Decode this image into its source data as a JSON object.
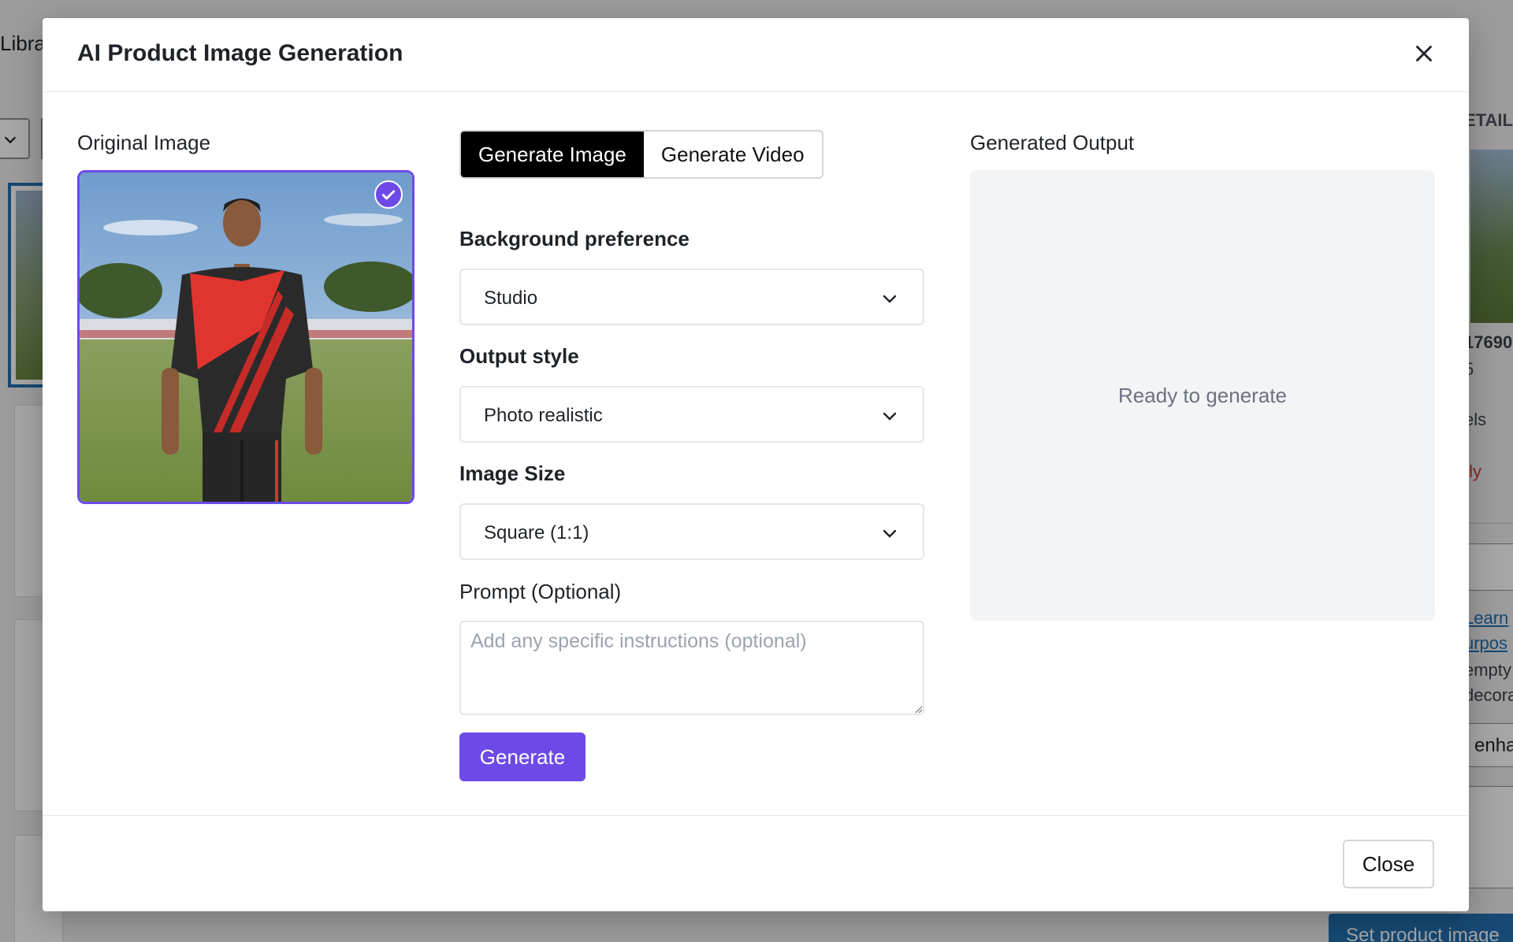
{
  "background": {
    "tab_label": "Libra",
    "right_panel": {
      "header": "ETAIL",
      "filename": "17690",
      "line2": "5",
      "dims_suffix": "els",
      "delete_link": "tly",
      "learn_link": "Learn",
      "purpose_link": "urpos",
      "empty_text": "empty",
      "decor_text": "decora",
      "alt_value": "enha"
    },
    "set_product_image_button": "Set product image"
  },
  "modal": {
    "title": "AI Product Image Generation",
    "original_image_label": "Original Image",
    "tabs": [
      {
        "label": "Generate Image",
        "active": true
      },
      {
        "label": "Generate Video",
        "active": false
      }
    ],
    "background_preference": {
      "label": "Background preference",
      "value": "Studio"
    },
    "output_style": {
      "label": "Output style",
      "value": "Photo realistic"
    },
    "image_size": {
      "label": "Image Size",
      "value": "Square (1:1)"
    },
    "prompt": {
      "label": "Prompt (Optional)",
      "placeholder": "Add any specific instructions (optional)",
      "value": ""
    },
    "generate_button": "Generate",
    "generated_output_label": "Generated Output",
    "output_status": "Ready to generate",
    "close_button": "Close"
  },
  "colors": {
    "accent": "#6d4ae8",
    "tab_active_bg": "#000000",
    "output_bg": "#f3f4f6",
    "wp_blue": "#2271b1"
  },
  "icons": {
    "close": "close-icon",
    "chevron": "chevron-down-icon",
    "check": "check-circle-icon"
  }
}
